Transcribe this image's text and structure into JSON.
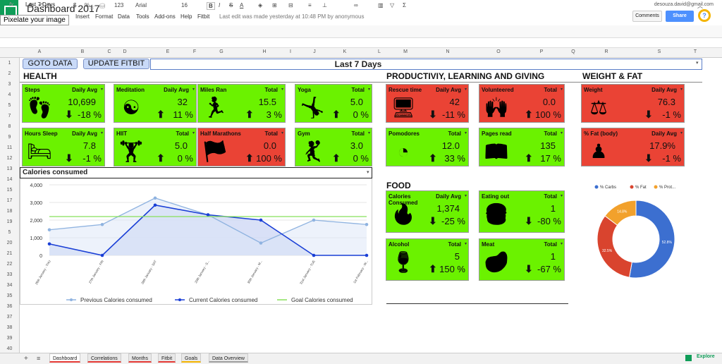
{
  "app": {
    "title": "Dashboard 2017",
    "tooltip": "Pixelate your image",
    "user": "desouza.david@gmail.com",
    "comments": "Comments",
    "share": "Share",
    "help": "?",
    "menu": [
      "Insert",
      "Format",
      "Data",
      "Tools",
      "Add-ons",
      "Help",
      "Fitbit"
    ],
    "last_edit": "Last edit was made yesterday at 10:48 PM by anonymous",
    "toolbar": {
      "zoom": "123",
      "font": "Arial",
      "size": "16",
      "bold": "B",
      "italic": "I",
      "strike": "S",
      "text_color": "A"
    },
    "formula": {
      "fx": "fx",
      "value": "Last 7 Days"
    },
    "columns": [
      "A",
      "B",
      "C",
      "D",
      "E",
      "F",
      "G",
      "H",
      "I",
      "J",
      "K",
      "L",
      "M",
      "N",
      "O",
      "P",
      "Q",
      "R",
      "S",
      "T",
      "U"
    ],
    "rows": [
      "1",
      "2",
      "3",
      "4",
      "5",
      "7",
      "8",
      "9",
      "11",
      "12",
      "13",
      "14",
      "15",
      "17",
      "18",
      "19",
      "5",
      "20",
      "21",
      "22",
      "33",
      "34",
      "35",
      "36",
      "37",
      "38",
      "39",
      "40"
    ],
    "sheets": [
      "Dashboard",
      "Correlations",
      "Months",
      "Fitbit",
      "Goals",
      "Data Overview"
    ],
    "explore": "Explore"
  },
  "dashboard": {
    "goto": "GOTO DATA",
    "update": "UPDATE FITBIT",
    "period": "Last 7 Days",
    "sections": {
      "health": "HEALTH",
      "productivity": "PRODUCTIVIY, LEARNING AND GIVING",
      "weight": "WEIGHT & FAT",
      "food": "FOOD",
      "calories": "Calories consumed"
    },
    "tiles": [
      {
        "title": "Steps",
        "metric": "Daily Avg",
        "value": "10,699",
        "change": "-18 %",
        "dir": "down",
        "color": "green",
        "icon": "footsteps-icon"
      },
      {
        "title": "Meditation",
        "metric": "Daily Avg",
        "value": "32",
        "change": "11 %",
        "dir": "up",
        "color": "green",
        "icon": "meditation-icon"
      },
      {
        "title": "Miles Ran",
        "metric": "Total",
        "value": "15.5",
        "change": "3 %",
        "dir": "up",
        "color": "green",
        "icon": "runner-icon"
      },
      {
        "title": "Yoga",
        "metric": "Total",
        "value": "5.0",
        "change": "0 %",
        "dir": "up",
        "color": "green",
        "icon": "yoga-icon"
      },
      {
        "title": "Hours Sleep",
        "metric": "Daily Avg",
        "value": "7.8",
        "change": "-1 %",
        "dir": "down",
        "color": "green",
        "icon": "bed-icon"
      },
      {
        "title": "HIIT",
        "metric": "Total",
        "value": "5.0",
        "change": "0 %",
        "dir": "up",
        "color": "green",
        "icon": "weightlifting-icon"
      },
      {
        "title": "Half Marathons",
        "metric": "Total",
        "value": "0.0",
        "change": "100 %",
        "dir": "up",
        "color": "red",
        "icon": "finish-line-icon"
      },
      {
        "title": "Gym",
        "metric": "Total",
        "value": "3.0",
        "change": "0 %",
        "dir": "up",
        "color": "green",
        "icon": "pushup-icon"
      },
      {
        "title": "Rescue time",
        "metric": "Daily Avg",
        "value": "42",
        "change": "-11 %",
        "dir": "down",
        "color": "red",
        "icon": "computer-icon"
      },
      {
        "title": "Volunteered",
        "metric": "Total",
        "value": "0.0",
        "change": "100 %",
        "dir": "up",
        "color": "red",
        "icon": "hands-up-icon"
      },
      {
        "title": "Weight",
        "metric": "Daily Avg",
        "value": "76.3",
        "change": "-1 %",
        "dir": "down",
        "color": "red",
        "icon": "scale-icon"
      },
      {
        "title": "Pomodores",
        "metric": "Total",
        "value": "12.0",
        "change": "33 %",
        "dir": "up",
        "color": "green",
        "icon": "clock-icon"
      },
      {
        "title": "Pages read",
        "metric": "Total",
        "value": "135",
        "change": "17 %",
        "dir": "up",
        "color": "green",
        "icon": "book-icon"
      },
      {
        "title": "% Fat (body)",
        "metric": "Daily Avg",
        "value": "17.9%",
        "change": "-1 %",
        "dir": "down",
        "color": "red",
        "icon": "body-fat-icon"
      },
      {
        "title": "Calories Consumed",
        "metric": "Daily Avg",
        "value": "1,374",
        "change": "-25 %",
        "dir": "down",
        "color": "green",
        "icon": "flame-icon"
      },
      {
        "title": "Eating out",
        "metric": "Total",
        "value": "1",
        "change": "-80 %",
        "dir": "down",
        "color": "green",
        "icon": "fast-food-icon"
      },
      {
        "title": "Alcohol",
        "metric": "Total",
        "value": "5",
        "change": "150 %",
        "dir": "up",
        "color": "green",
        "icon": "wine-icon"
      },
      {
        "title": "Meat",
        "metric": "Total",
        "value": "1",
        "change": "-67 %",
        "dir": "down",
        "color": "green",
        "icon": "steak-icon"
      }
    ]
  },
  "chart_data": [
    {
      "type": "line",
      "title": "Calories consumed",
      "categories": [
        "26th January - THU",
        "27th January - FRI",
        "28th January - SAT",
        "29th January - S...",
        "30th January - M...",
        "31st January - TUE",
        "1st February - W..."
      ],
      "series": [
        {
          "name": "Previous Calories consumed",
          "values": [
            1450,
            1750,
            3250,
            2300,
            700,
            2000,
            1750
          ],
          "color": "#8fb3e0"
        },
        {
          "name": "Current Calories consumed",
          "values": [
            650,
            0,
            2850,
            2300,
            2000,
            0,
            0
          ],
          "color": "#1a3fd6"
        },
        {
          "name": "Goal Calories consumed",
          "values": [
            2200,
            2200,
            2200,
            2200,
            2200,
            2200,
            2200
          ],
          "color": "#88e05a"
        }
      ],
      "yticks": [
        "0",
        "1,000",
        "2,000",
        "3,000",
        "4,000"
      ],
      "ylim": [
        0,
        4000
      ],
      "legend": "bottom"
    },
    {
      "type": "pie",
      "slices": [
        {
          "name": "% Carbs",
          "value": 52.8,
          "label": "52.8%",
          "color": "#3c6fd0"
        },
        {
          "name": "% Fat",
          "value": 32.5,
          "label": "32.5%",
          "color": "#d9442e"
        },
        {
          "name": "% Prot...",
          "value": 14.8,
          "label": "14.8%",
          "color": "#f2a12c"
        }
      ],
      "legend": "top"
    }
  ]
}
